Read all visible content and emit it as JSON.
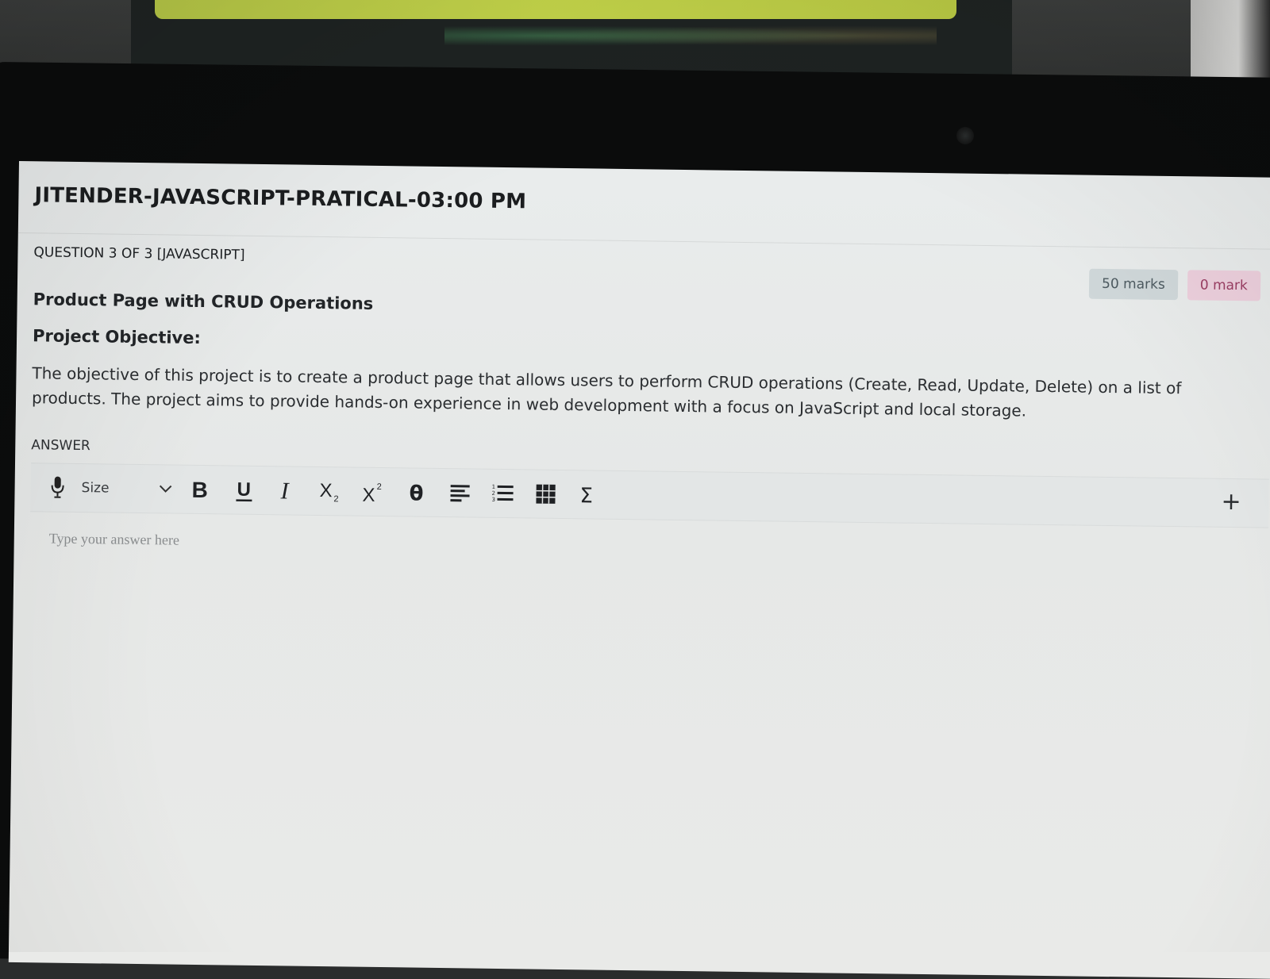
{
  "exam": {
    "title": "JITENDER-JAVASCRIPT-PRATICAL-03:00 PM"
  },
  "question": {
    "counter": "QUESTION 3 OF 3 [JAVASCRIPT]",
    "title": "Product Page with CRUD Operations",
    "objective_heading": "Project Objective:",
    "objective_text": "The objective of this project is to create a product page that allows users to perform CRUD operations (Create, Read, Update, Delete) on a list of products. The project aims to provide hands-on experience in web development with a focus on JavaScript and local storage.",
    "marks_total": "50 marks",
    "marks_scored": "0 mark"
  },
  "answer": {
    "label": "ANSWER",
    "placeholder": "Type your answer here"
  },
  "toolbar": {
    "size_label": "Size",
    "plus_label": "+",
    "tools": [
      {
        "icon": "microphone-icon"
      },
      {
        "icon": "chevron-down-icon"
      },
      {
        "icon": "bold-icon"
      },
      {
        "icon": "underline-icon"
      },
      {
        "icon": "italic-icon"
      },
      {
        "icon": "subscript-icon"
      },
      {
        "icon": "superscript-icon"
      },
      {
        "icon": "theta-icon"
      },
      {
        "icon": "align-icon"
      },
      {
        "icon": "numbered-list-icon"
      },
      {
        "icon": "table-icon"
      },
      {
        "icon": "sigma-icon"
      }
    ]
  },
  "colors": {
    "marks_total_bg": "#cfd7d9",
    "marks_scored_bg": "#eccfdc",
    "marks_scored_text": "#9a3e63"
  }
}
